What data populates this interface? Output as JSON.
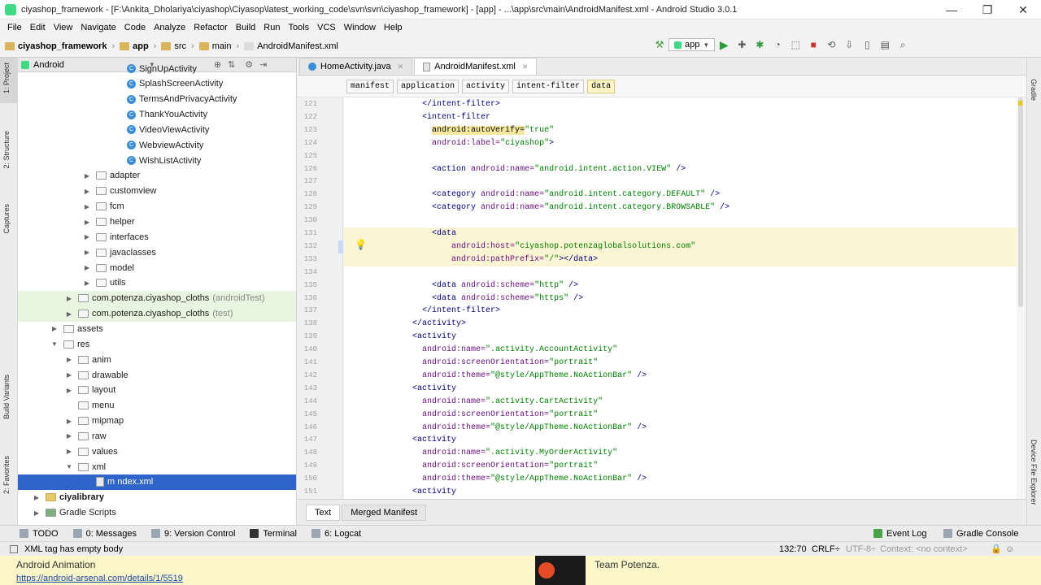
{
  "window": {
    "title": "ciyashop_framework - [F:\\Ankita_Dholariya\\ciyashop\\Ciyasop\\latest_working_code\\svn\\svn\\ciyashop_framework] - [app] - ...\\app\\src\\main\\AndroidManifest.xml - Android Studio 3.0.1",
    "minimize": "—",
    "maximize": "❒",
    "close": "✕"
  },
  "menu": [
    "File",
    "Edit",
    "View",
    "Navigate",
    "Code",
    "Analyze",
    "Refactor",
    "Build",
    "Run",
    "Tools",
    "VCS",
    "Window",
    "Help"
  ],
  "breadcrumb": [
    "ciyashop_framework",
    "app",
    "src",
    "main",
    "AndroidManifest.xml"
  ],
  "run_config": "app",
  "left_tabs": [
    "1: Project",
    "2: Structure",
    "Captures",
    "Build Variants",
    "2: Favorites"
  ],
  "right_tabs": [
    "Gradle",
    "Device File Explorer"
  ],
  "project_panel": {
    "view_mode": "Android",
    "tree": [
      {
        "label": "SignUpActivity",
        "type": "class",
        "indent": 100,
        "arrow": ""
      },
      {
        "label": "SplashScreenActivity",
        "type": "class",
        "indent": 100,
        "arrow": ""
      },
      {
        "label": "TermsAndPrivacyActivity",
        "type": "class",
        "indent": 100,
        "arrow": ""
      },
      {
        "label": "ThankYouActivity",
        "type": "class",
        "indent": 100,
        "arrow": ""
      },
      {
        "label": "VideoViewActivity",
        "type": "class",
        "indent": 100,
        "arrow": ""
      },
      {
        "label": "WebviewActivity",
        "type": "class",
        "indent": 100,
        "arrow": ""
      },
      {
        "label": "WishListActivity",
        "type": "class",
        "indent": 100,
        "arrow": ""
      },
      {
        "label": "adapter",
        "type": "folder",
        "indent": 62,
        "arrow": "▶"
      },
      {
        "label": "customview",
        "type": "folder",
        "indent": 62,
        "arrow": "▶"
      },
      {
        "label": "fcm",
        "type": "folder",
        "indent": 62,
        "arrow": "▶"
      },
      {
        "label": "helper",
        "type": "folder",
        "indent": 62,
        "arrow": "▶"
      },
      {
        "label": "interfaces",
        "type": "folder",
        "indent": 62,
        "arrow": "▶"
      },
      {
        "label": "javaclasses",
        "type": "folder",
        "indent": 62,
        "arrow": "▶"
      },
      {
        "label": "model",
        "type": "folder",
        "indent": 62,
        "arrow": "▶"
      },
      {
        "label": "utils",
        "type": "folder",
        "indent": 62,
        "arrow": "▶"
      },
      {
        "label": "com.potenza.ciyashop_cloths",
        "type": "folder",
        "indent": 40,
        "arrow": "▶",
        "suffix": "(androidTest)",
        "green": true
      },
      {
        "label": "com.potenza.ciyashop_cloths",
        "type": "folder",
        "indent": 40,
        "arrow": "▶",
        "suffix": "(test)",
        "green": true
      },
      {
        "label": "assets",
        "type": "folder",
        "indent": 22,
        "arrow": "▶"
      },
      {
        "label": "res",
        "type": "folder",
        "indent": 22,
        "arrow": "▼"
      },
      {
        "label": "anim",
        "type": "folder",
        "indent": 40,
        "arrow": "▶"
      },
      {
        "label": "drawable",
        "type": "folder",
        "indent": 40,
        "arrow": "▶"
      },
      {
        "label": "layout",
        "type": "folder",
        "indent": 40,
        "arrow": "▶"
      },
      {
        "label": "menu",
        "type": "folder",
        "indent": 40,
        "arrow": ""
      },
      {
        "label": "mipmap",
        "type": "folder",
        "indent": 40,
        "arrow": "▶"
      },
      {
        "label": "raw",
        "type": "folder",
        "indent": 40,
        "arrow": "▶"
      },
      {
        "label": "values",
        "type": "folder",
        "indent": 40,
        "arrow": "▶"
      },
      {
        "label": "xml",
        "type": "folder",
        "indent": 40,
        "arrow": "▼"
      },
      {
        "label": "m ndex.xml",
        "type": "xml",
        "indent": 62,
        "arrow": "",
        "selected": true
      },
      {
        "label": "ciyalibrary",
        "type": "module",
        "indent": 0,
        "arrow": "▶",
        "bold": true
      },
      {
        "label": "Gradle Scripts",
        "type": "gradle",
        "indent": 0,
        "arrow": "▶"
      }
    ]
  },
  "editor": {
    "tabs": [
      {
        "label": "HomeActivity.java",
        "active": false
      },
      {
        "label": "AndroidManifest.xml",
        "active": true
      }
    ],
    "xml_breadcrumb": [
      "manifest",
      "application",
      "activity",
      "intent-filter",
      "data"
    ],
    "lines": [
      {
        "n": "121",
        "indent": 6,
        "parts": [
          [
            "tag",
            "</intent-filter>"
          ]
        ]
      },
      {
        "n": "122",
        "indent": 6,
        "parts": [
          [
            "tag",
            "<intent-filter"
          ]
        ]
      },
      {
        "n": "123",
        "indent": 8,
        "parts": [
          [
            "mk",
            "android"
          ],
          [
            "mk",
            ":autoVerify="
          ],
          [
            "val",
            "\"true\""
          ]
        ]
      },
      {
        "n": "124",
        "indent": 8,
        "parts": [
          [
            "ns",
            "android"
          ],
          [
            "attr",
            ":label="
          ],
          [
            "val",
            "\"ciyashop\""
          ],
          [
            "tag",
            ">"
          ]
        ]
      },
      {
        "n": "125",
        "indent": 0,
        "parts": []
      },
      {
        "n": "126",
        "indent": 8,
        "parts": [
          [
            "tag",
            "<action "
          ],
          [
            "ns",
            "android"
          ],
          [
            "attr",
            ":name="
          ],
          [
            "val",
            "\"android.intent.action.VIEW\""
          ],
          [
            "tag",
            " />"
          ]
        ]
      },
      {
        "n": "127",
        "indent": 0,
        "parts": []
      },
      {
        "n": "128",
        "indent": 8,
        "parts": [
          [
            "tag",
            "<category "
          ],
          [
            "ns",
            "android"
          ],
          [
            "attr",
            ":name="
          ],
          [
            "val",
            "\"android.intent.category.DEFAULT\""
          ],
          [
            "tag",
            " />"
          ]
        ]
      },
      {
        "n": "129",
        "indent": 8,
        "parts": [
          [
            "tag",
            "<category "
          ],
          [
            "ns",
            "android"
          ],
          [
            "attr",
            ":name="
          ],
          [
            "val",
            "\"android.intent.category.BROWSABLE\""
          ],
          [
            "tag",
            " />"
          ]
        ]
      },
      {
        "n": "130",
        "indent": 0,
        "parts": []
      },
      {
        "n": "131",
        "indent": 8,
        "parts": [
          [
            "tag",
            "<data"
          ]
        ],
        "hl": true
      },
      {
        "n": "132",
        "indent": 12,
        "parts": [
          [
            "ns",
            "android"
          ],
          [
            "attr",
            ":host="
          ],
          [
            "val",
            "\"ciyashop.potenzaglobalsolutions.com\""
          ]
        ],
        "hl": true
      },
      {
        "n": "133",
        "indent": 12,
        "parts": [
          [
            "ns",
            "android"
          ],
          [
            "attr",
            ":pathPrefix="
          ],
          [
            "val",
            "\"/\""
          ],
          [
            "tag",
            "></data>"
          ]
        ],
        "hl": true
      },
      {
        "n": "134",
        "indent": 0,
        "parts": []
      },
      {
        "n": "135",
        "indent": 8,
        "parts": [
          [
            "tag",
            "<data "
          ],
          [
            "ns",
            "android"
          ],
          [
            "attr",
            ":scheme="
          ],
          [
            "val",
            "\"http\""
          ],
          [
            "tag",
            " />"
          ]
        ]
      },
      {
        "n": "136",
        "indent": 8,
        "parts": [
          [
            "tag",
            "<data "
          ],
          [
            "ns",
            "android"
          ],
          [
            "attr",
            ":scheme="
          ],
          [
            "val",
            "\"https\""
          ],
          [
            "tag",
            " />"
          ]
        ]
      },
      {
        "n": "137",
        "indent": 6,
        "parts": [
          [
            "tag",
            "</intent-filter>"
          ]
        ]
      },
      {
        "n": "138",
        "indent": 4,
        "parts": [
          [
            "tag",
            "</activity>"
          ]
        ]
      },
      {
        "n": "139",
        "indent": 4,
        "parts": [
          [
            "tag",
            "<activity"
          ]
        ]
      },
      {
        "n": "140",
        "indent": 6,
        "parts": [
          [
            "ns",
            "android"
          ],
          [
            "attr",
            ":name="
          ],
          [
            "val",
            "\".activity.AccountActivity\""
          ]
        ]
      },
      {
        "n": "141",
        "indent": 6,
        "parts": [
          [
            "ns",
            "android"
          ],
          [
            "attr",
            ":screenOrientation="
          ],
          [
            "val",
            "\"portrait\""
          ]
        ]
      },
      {
        "n": "142",
        "indent": 6,
        "parts": [
          [
            "ns",
            "android"
          ],
          [
            "attr",
            ":theme="
          ],
          [
            "val",
            "\"@style/AppTheme.NoActionBar\""
          ],
          [
            "tag",
            " />"
          ]
        ]
      },
      {
        "n": "143",
        "indent": 4,
        "parts": [
          [
            "tag",
            "<activity"
          ]
        ]
      },
      {
        "n": "144",
        "indent": 6,
        "parts": [
          [
            "ns",
            "android"
          ],
          [
            "attr",
            ":name="
          ],
          [
            "val",
            "\".activity.CartActivity\""
          ]
        ]
      },
      {
        "n": "145",
        "indent": 6,
        "parts": [
          [
            "ns",
            "android"
          ],
          [
            "attr",
            ":screenOrientation="
          ],
          [
            "val",
            "\"portrait\""
          ]
        ]
      },
      {
        "n": "146",
        "indent": 6,
        "parts": [
          [
            "ns",
            "android"
          ],
          [
            "attr",
            ":theme="
          ],
          [
            "val",
            "\"@style/AppTheme.NoActionBar\""
          ],
          [
            "tag",
            " />"
          ]
        ]
      },
      {
        "n": "147",
        "indent": 4,
        "parts": [
          [
            "tag",
            "<activity"
          ]
        ]
      },
      {
        "n": "148",
        "indent": 6,
        "parts": [
          [
            "ns",
            "android"
          ],
          [
            "attr",
            ":name="
          ],
          [
            "val",
            "\".activity.MyOrderActivity\""
          ]
        ]
      },
      {
        "n": "149",
        "indent": 6,
        "parts": [
          [
            "ns",
            "android"
          ],
          [
            "attr",
            ":screenOrientation="
          ],
          [
            "val",
            "\"portrait\""
          ]
        ]
      },
      {
        "n": "150",
        "indent": 6,
        "parts": [
          [
            "ns",
            "android"
          ],
          [
            "attr",
            ":theme="
          ],
          [
            "val",
            "\"@style/AppTheme.NoActionBar\""
          ],
          [
            "tag",
            " />"
          ]
        ]
      },
      {
        "n": "151",
        "indent": 4,
        "parts": [
          [
            "tag",
            "<activity"
          ]
        ]
      }
    ],
    "bottom_tabs": [
      {
        "label": "Text",
        "active": true
      },
      {
        "label": "Merged Manifest",
        "active": false
      }
    ]
  },
  "tool_windows": [
    "TODO",
    "0: Messages",
    "9: Version Control",
    "Terminal",
    "6: Logcat"
  ],
  "tool_windows_right": [
    "Event Log",
    "Gradle Console"
  ],
  "status": {
    "message": "XML tag has empty body",
    "position": "132:70",
    "line_sep": "CRLF÷",
    "encoding": "UTF-8÷",
    "context": "Context: <no context>"
  },
  "banner": {
    "title": "Android Animation",
    "link": "https://android-arsenal.com/details/1/5519",
    "author": "Team Potenza."
  }
}
